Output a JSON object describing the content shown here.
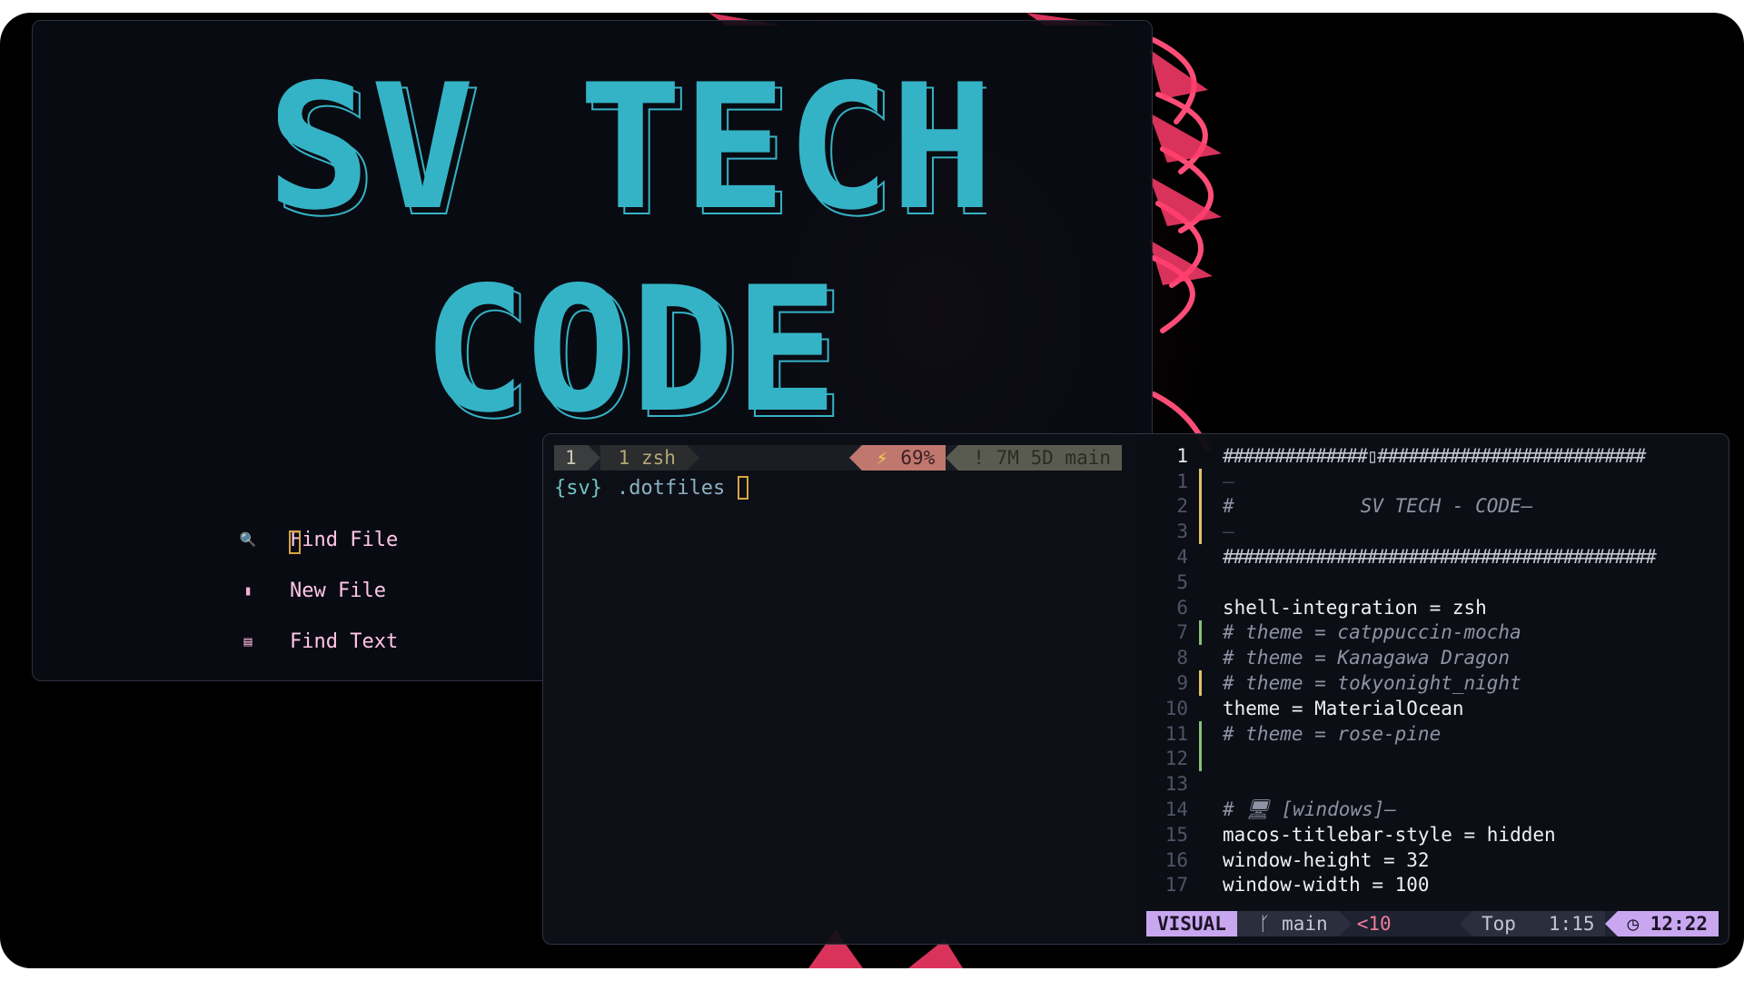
{
  "colors": {
    "logo_fill": "#35b3c6",
    "menu_text": "#ffc6e4",
    "mode_bg": "#c9a7f0",
    "git_added": "#87c07a",
    "git_changed": "#e0c06e"
  },
  "dashboard": {
    "logo_line1": "SV TECH",
    "logo_line2": "CODE",
    "menu": [
      {
        "icon": "search-icon",
        "glyph": "🔍",
        "label": "Find File"
      },
      {
        "icon": "file-icon",
        "glyph": "▮",
        "label": "New File"
      },
      {
        "icon": "text-icon",
        "glyph": "▤",
        "label": "Find Text"
      }
    ]
  },
  "tmux": {
    "index": "1",
    "window": "1 zsh",
    "battery": "69%",
    "git": "! 7M 5D main"
  },
  "prompt": {
    "user": "{sv}",
    "dir": ".dotfiles"
  },
  "editor": {
    "lines": [
      {
        "n": "1",
        "text": "##############▯##########################",
        "kind": "hash",
        "current": true
      },
      {
        "n": "1",
        "text": "–",
        "kind": "dim",
        "sign": "yellow"
      },
      {
        "n": "2",
        "text": "#           SV TECH - CODE–",
        "kind": "comment",
        "sign": "yellow"
      },
      {
        "n": "3",
        "text": "–",
        "kind": "dim",
        "sign": "yellow"
      },
      {
        "n": "4",
        "text": "##########################################",
        "kind": "hash"
      },
      {
        "n": "5",
        "text": "",
        "kind": "code"
      },
      {
        "n": "6",
        "text": "shell-integration = zsh",
        "kind": "code"
      },
      {
        "n": "7",
        "text": "# theme = catppuccin-mocha",
        "kind": "comment",
        "sign": "green"
      },
      {
        "n": "8",
        "text": "# theme = Kanagawa Dragon",
        "kind": "comment"
      },
      {
        "n": "9",
        "text": "# theme = tokyonight_night",
        "kind": "comment",
        "sign": "yellow"
      },
      {
        "n": "10",
        "text": "theme = MaterialOcean",
        "kind": "code"
      },
      {
        "n": "11",
        "text": "# theme = rose-pine",
        "kind": "comment",
        "sign": "green"
      },
      {
        "n": "12",
        "text": "",
        "kind": "code",
        "sign": "green"
      },
      {
        "n": "13",
        "text": "",
        "kind": "code"
      },
      {
        "n": "14",
        "text": "# 🖥 [windows]–",
        "kind": "comment"
      },
      {
        "n": "15",
        "text": "macos-titlebar-style = hidden",
        "kind": "code"
      },
      {
        "n": "16",
        "text": "window-height = 32",
        "kind": "code"
      },
      {
        "n": "17",
        "text": "window-width = 100",
        "kind": "code"
      }
    ],
    "status": {
      "mode": "VISUAL",
      "branch": "main",
      "diag": "<10",
      "scroll": "Top",
      "cursor": "1:15",
      "time": "12:22"
    }
  }
}
